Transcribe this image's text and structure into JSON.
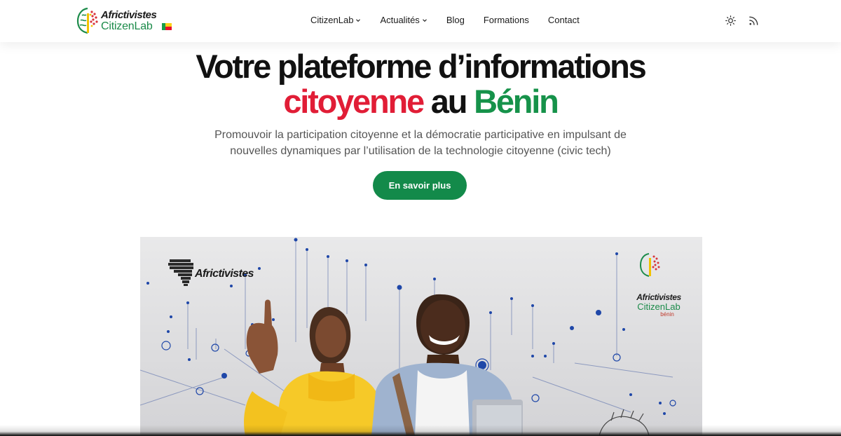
{
  "header": {
    "logo": {
      "brand_top": "Africtivistes",
      "brand_bottom": "CitizenLab",
      "flag_colors": [
        "#179d4b",
        "#fcd116",
        "#e8112d"
      ]
    },
    "nav": [
      {
        "label": "CitizenLab",
        "has_dropdown": true
      },
      {
        "label": "Actualités",
        "has_dropdown": true
      },
      {
        "label": "Blog",
        "has_dropdown": false
      },
      {
        "label": "Formations",
        "has_dropdown": false
      },
      {
        "label": "Contact",
        "has_dropdown": false
      }
    ],
    "icons": [
      "sun-icon",
      "rss-icon"
    ]
  },
  "hero": {
    "title_line1": "Votre plateforme d’informations",
    "title_word_red": "citoyenne",
    "title_mid": "au",
    "title_word_green": "Bénin",
    "subtitle": "Promouvoir la participation citoyenne et la démocratie participative en impulsant de nouvelles dynamiques par l’utilisation de la technologie citoyenne (civic tech)",
    "cta_label": "En savoir plus"
  },
  "banner": {
    "left_logo": "Africtivistes",
    "right_logo_top": "Africtivistes",
    "right_logo_middle": "CitizenLab",
    "right_logo_bottom": "bénin"
  },
  "colors": {
    "accent_red": "#e11d36",
    "accent_green": "#16924a",
    "button_green": "#138a4a"
  }
}
